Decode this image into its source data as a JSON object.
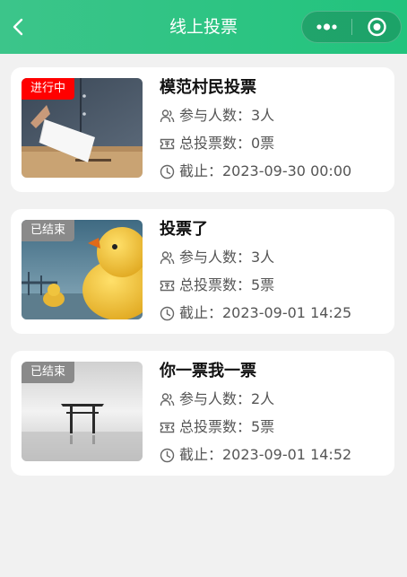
{
  "nav": {
    "title": "线上投票",
    "icons": {
      "back": "chevron-left-icon",
      "more": "more-dots-icon",
      "close": "target-close-icon"
    }
  },
  "vote_list": [
    {
      "title": "模范村民投票",
      "status": "进行中",
      "status_color": "#ff0000",
      "participants": "参与人数：3人",
      "total_votes": "总投票数：0票",
      "deadline": "截止：2023-09-30 00:00",
      "image": "ballot-box-image"
    },
    {
      "title": "投票了",
      "status": "已结束",
      "status_color": "#8a8a8a",
      "participants": "参与人数：3人",
      "total_votes": "总投票数：5票",
      "deadline": "截止：2023-09-01 14:25",
      "image": "rubber-duck-image"
    },
    {
      "title": "你一票我一票",
      "status": "已结束",
      "status_color": "#8a8a8a",
      "participants": "参与人数：2人",
      "total_votes": "总投票数：5票",
      "deadline": "截止：2023-09-01 14:52",
      "image": "torii-gate-image"
    }
  ],
  "colors": {
    "header_start": "#3cc58a",
    "header_end": "#21c37d",
    "background": "#f1f1f1",
    "card": "#ffffff",
    "active_badge": "#ff0000",
    "ended_badge": "#8a8a8a"
  }
}
